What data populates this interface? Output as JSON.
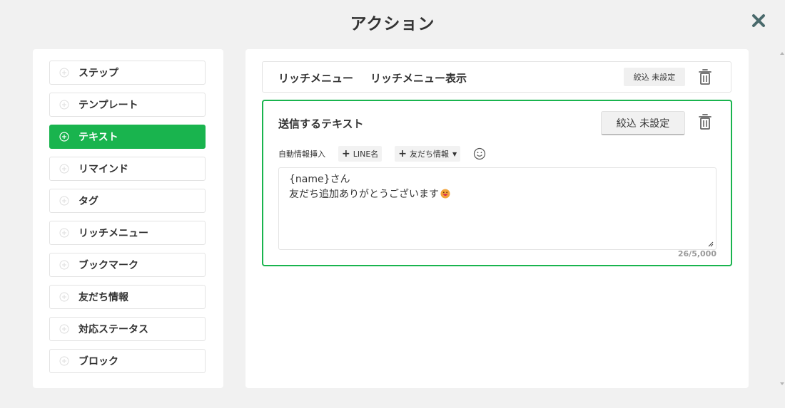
{
  "header": {
    "title": "アクション"
  },
  "sidebar": {
    "items": [
      {
        "label": "ステップ"
      },
      {
        "label": "テンプレート"
      },
      {
        "label": "テキスト",
        "active": true
      },
      {
        "label": "リマインド"
      },
      {
        "label": "タグ"
      },
      {
        "label": "リッチメニュー"
      },
      {
        "label": "ブックマーク"
      },
      {
        "label": "友だち情報"
      },
      {
        "label": "対応ステータス"
      },
      {
        "label": "ブロック"
      }
    ]
  },
  "rich_menu_action": {
    "name": "リッチメニュー",
    "value": "リッチメニュー表示",
    "filter_label": "絞込 未設定"
  },
  "text_action": {
    "title": "送信するテキスト",
    "filter_label": "絞込 未設定",
    "insert_label": "自動情報挿入",
    "insert_line_name": "LINE名",
    "insert_friend_info": "友だち情報",
    "line1": "{name}さん",
    "line2": "友だち追加ありがとうございます",
    "counter": "26/5,000"
  },
  "colors": {
    "accent": "#19b44e",
    "background": "#f1f1f1"
  },
  "icons": {
    "close": "close-icon",
    "trash": "trash-icon",
    "add": "plus-circle-icon",
    "emoji": "smiley-icon"
  }
}
